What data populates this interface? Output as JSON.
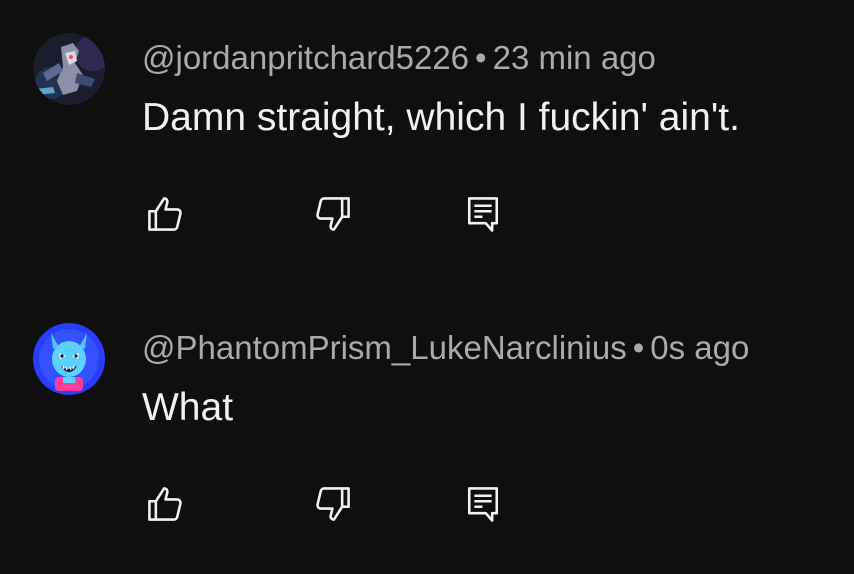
{
  "comments": [
    {
      "handle": "@jordanpritchard5226",
      "separator": "•",
      "time": "23 min ago",
      "text": "Damn straight, which I fuckin' ain't.",
      "avatar_icon": "character-avatar-icon"
    },
    {
      "handle": "@PhantomPrism_LukeNarclinius",
      "separator": "•",
      "time": "0s ago",
      "text": "What",
      "avatar_icon": "blue-creature-avatar-icon"
    }
  ],
  "icons": {
    "like": "thumbs-up-icon",
    "dislike": "thumbs-down-icon",
    "reply": "reply-icon"
  },
  "colors": {
    "background": "#0f0f0f",
    "primary_text": "#f1f1f1",
    "secondary_text": "#aaaaaa",
    "avatar2_bg": "#2a3cff"
  }
}
